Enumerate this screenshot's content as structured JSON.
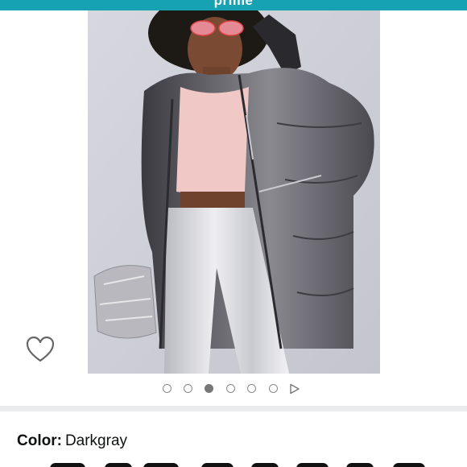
{
  "header": {
    "banner_text": "prime",
    "banner_color": "#17a2b3"
  },
  "product_image": {
    "alt": "Model wearing a metallic gray hooded puffer parka with pink crop top and silver pants, holding a silver clutch",
    "background": "#cfd0d8"
  },
  "wishlist": {
    "icon": "heart-outline-icon"
  },
  "carousel": {
    "dots": [
      {
        "active": false
      },
      {
        "active": false
      },
      {
        "active": true
      },
      {
        "active": false
      },
      {
        "active": false
      },
      {
        "active": false
      }
    ],
    "next_icon": "play-triangle-icon"
  },
  "variant": {
    "label": "Color:",
    "value": "Darkgray"
  }
}
